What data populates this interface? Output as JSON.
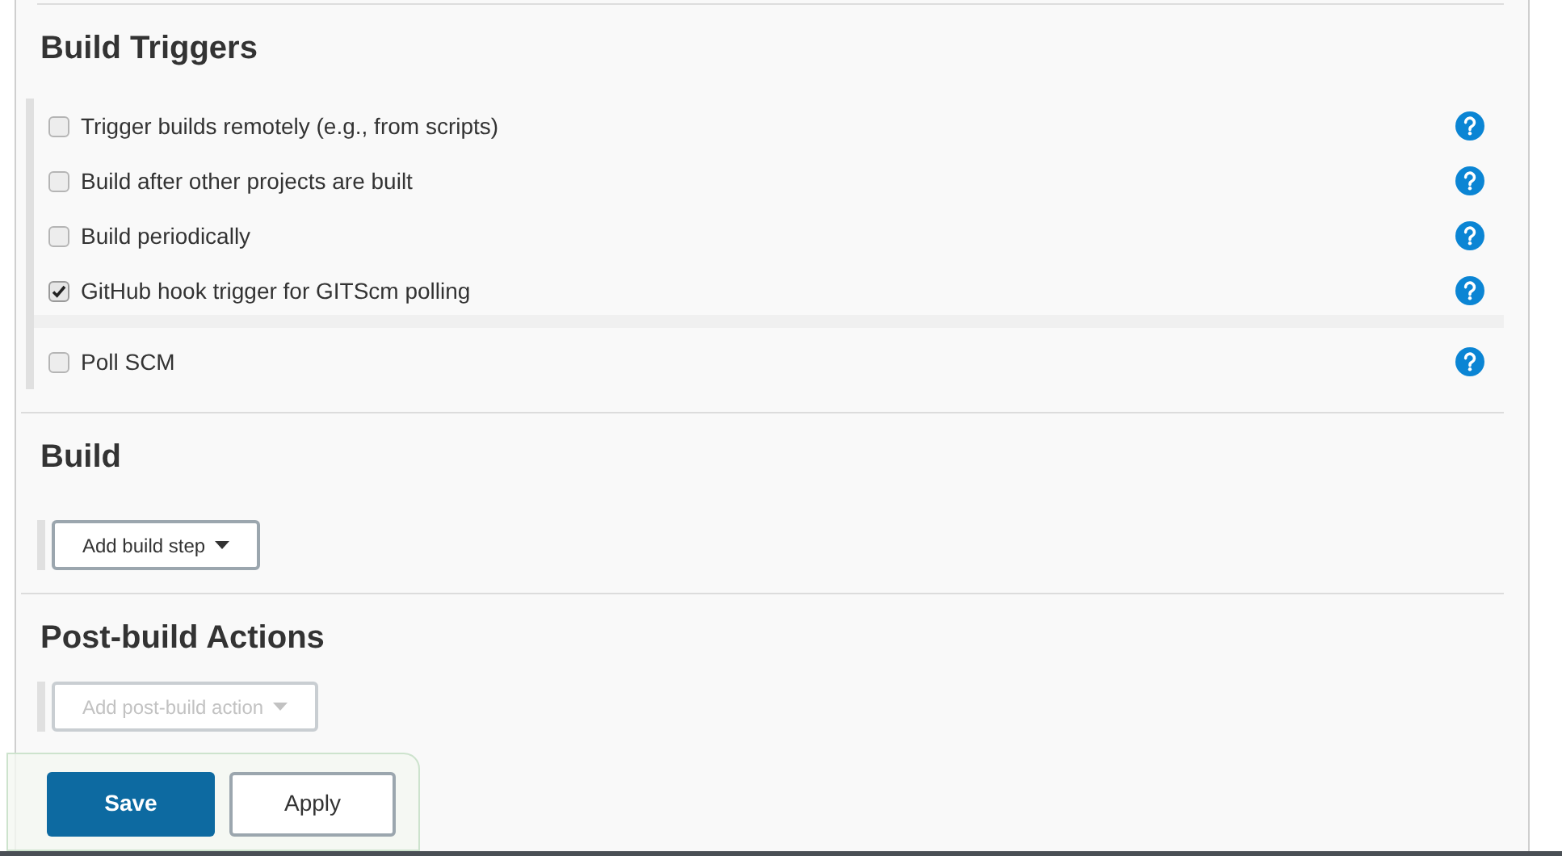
{
  "sections": [
    {
      "title": "Build Triggers",
      "kind": "checkboxes",
      "options": [
        {
          "label": "Trigger builds remotely (e.g., from scripts)",
          "checked": false
        },
        {
          "label": "Build after other projects are built",
          "checked": false
        },
        {
          "label": "Build periodically",
          "checked": false
        },
        {
          "label": "GitHub hook trigger for GITScm polling",
          "checked": true
        },
        {
          "label": "Poll SCM",
          "checked": false
        }
      ]
    },
    {
      "title": "Build",
      "kind": "dropdown",
      "button": {
        "label": "Add build step",
        "disabled": false
      }
    },
    {
      "title": "Post-build Actions",
      "kind": "dropdown",
      "button": {
        "label": "Add post-build action",
        "disabled": true
      }
    }
  ],
  "footer": {
    "buttons": [
      {
        "label": "Save",
        "kind": "primary"
      },
      {
        "label": "Apply",
        "kind": "secondary"
      }
    ]
  }
}
